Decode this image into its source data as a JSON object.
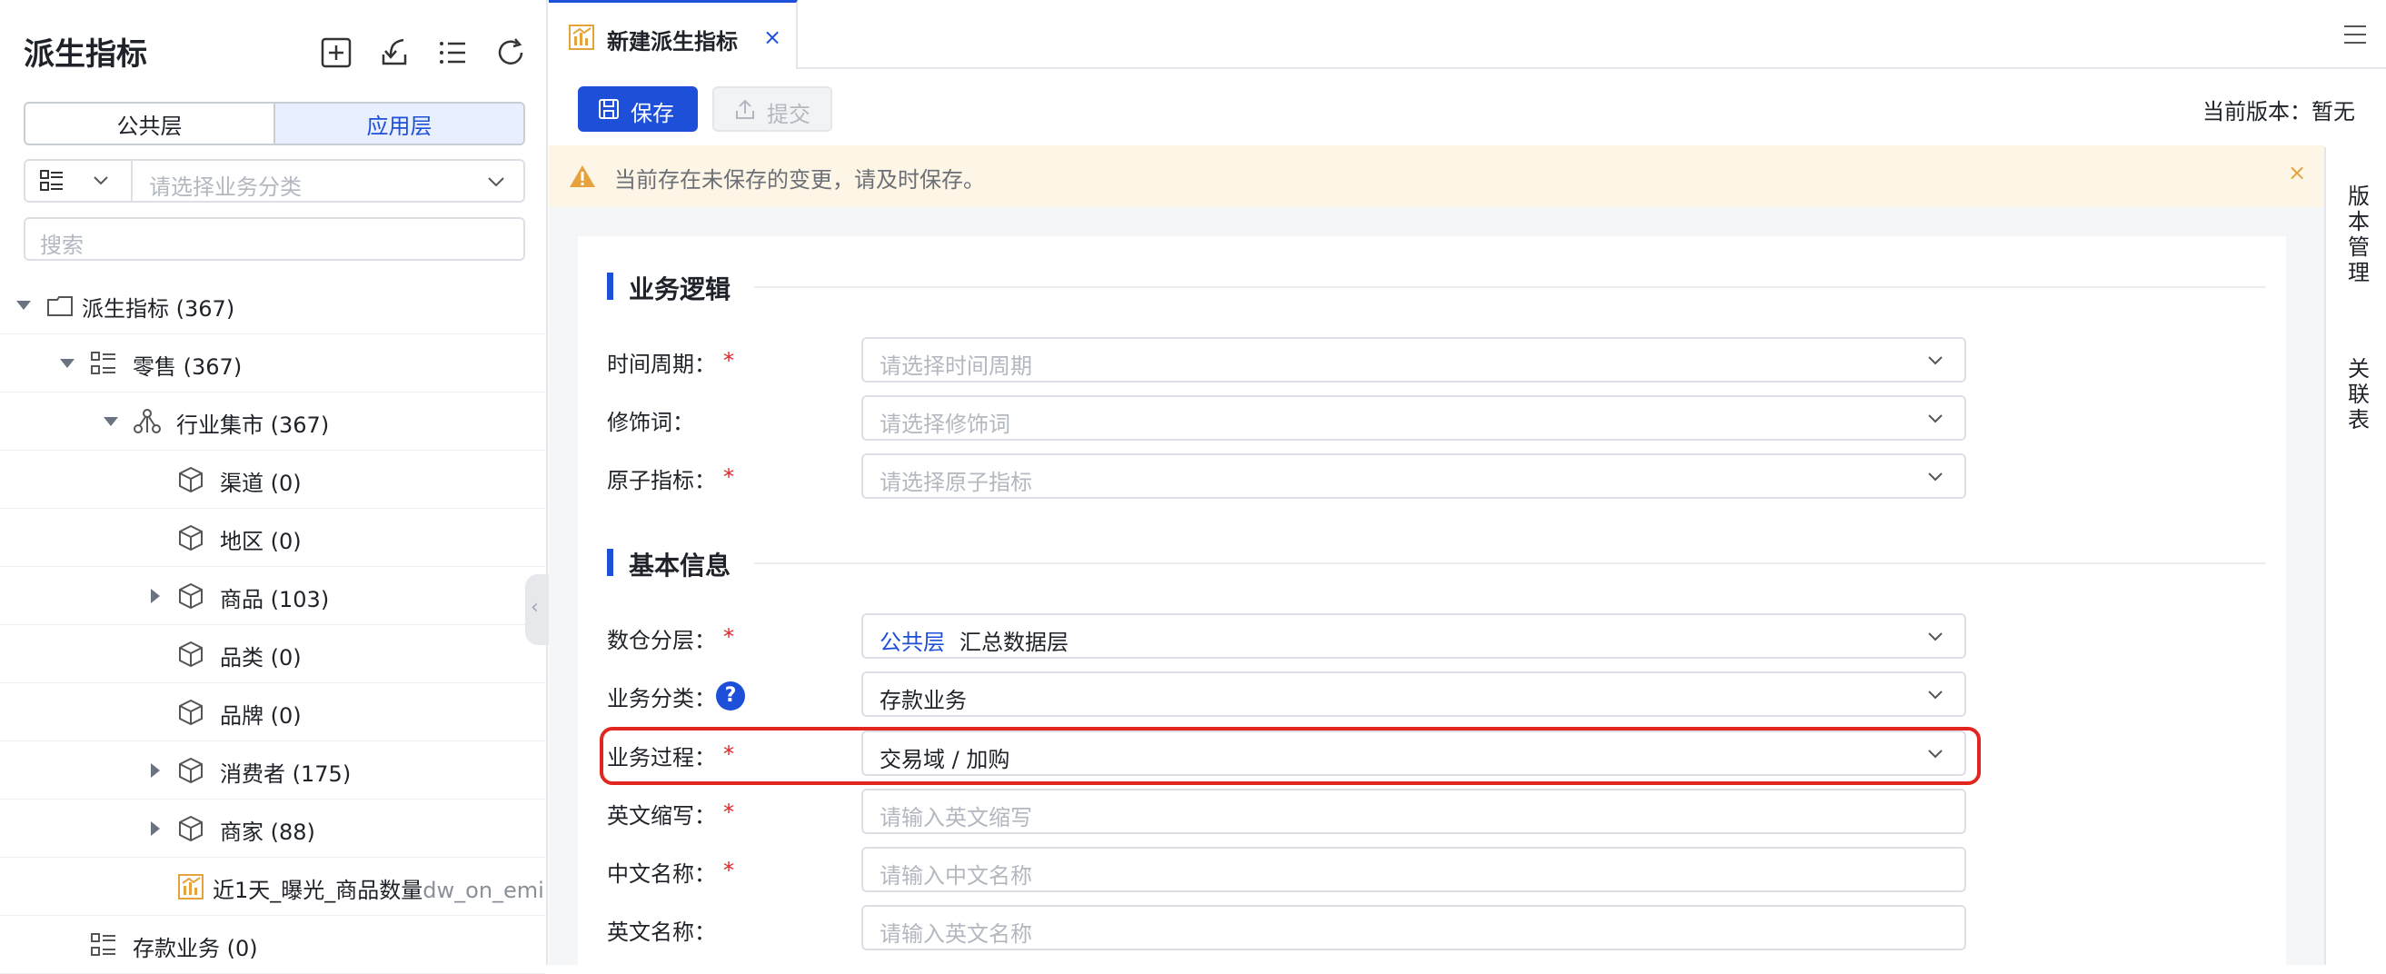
{
  "sidebar": {
    "title": "派生指标",
    "tabs": {
      "public": "公共层",
      "app": "应用层"
    },
    "category_placeholder": "请选择业务分类",
    "search_placeholder": "搜索",
    "tree": [
      {
        "label": "派生指标",
        "count": "(367)"
      },
      {
        "label": "零售",
        "count": "(367)"
      },
      {
        "label": "行业集市",
        "count": "(367)"
      },
      {
        "label": "渠道",
        "count": "(0)"
      },
      {
        "label": "地区",
        "count": "(0)"
      },
      {
        "label": "商品",
        "count": "(103)"
      },
      {
        "label": "品类",
        "count": "(0)"
      },
      {
        "label": "品牌",
        "count": "(0)"
      },
      {
        "label": "消费者",
        "count": "(175)"
      },
      {
        "label": "商家",
        "count": "(88)"
      },
      {
        "label": "近1天_曝光_商品数量",
        "code": "dw_on_emi"
      },
      {
        "label": "存款业务",
        "count": "(0)"
      }
    ]
  },
  "tab": {
    "label": "新建派生指标",
    "close": "×"
  },
  "toolbar": {
    "save": "保存",
    "submit": "提交",
    "version": "当前版本：暂无"
  },
  "alert": {
    "text": "当前存在未保存的变更，请及时保存。",
    "close": "×"
  },
  "right_panel": {
    "version_mgmt": "版本管理",
    "related_table": "关联表"
  },
  "sections": {
    "logic": "业务逻辑",
    "basic": "基本信息"
  },
  "form": {
    "time_period": {
      "label": "时间周期：",
      "placeholder": "请选择时间周期"
    },
    "modifier": {
      "label": "修饰词：",
      "placeholder": "请选择修饰词"
    },
    "atomic": {
      "label": "原子指标：",
      "placeholder": "请选择原子指标"
    },
    "layer": {
      "label": "数仓分层：",
      "tag": "公共层",
      "value": "汇总数据层"
    },
    "biz_category": {
      "label": "业务分类：",
      "value": "存款业务",
      "help": "?"
    },
    "biz_process": {
      "label": "业务过程：",
      "value": "交易域 / 加购"
    },
    "en_abbr": {
      "label": "英文缩写：",
      "placeholder": "请输入英文缩写"
    },
    "cn_name": {
      "label": "中文名称：",
      "placeholder": "请输入中文名称"
    },
    "en_name": {
      "label": "英文名称：",
      "placeholder": "请输入英文名称"
    },
    "required_mark": "*"
  },
  "colors": {
    "accent": "#1e4fd8",
    "required": "#e02424",
    "highlight": "#e0261f",
    "alert_bg": "#fdf5e6"
  }
}
